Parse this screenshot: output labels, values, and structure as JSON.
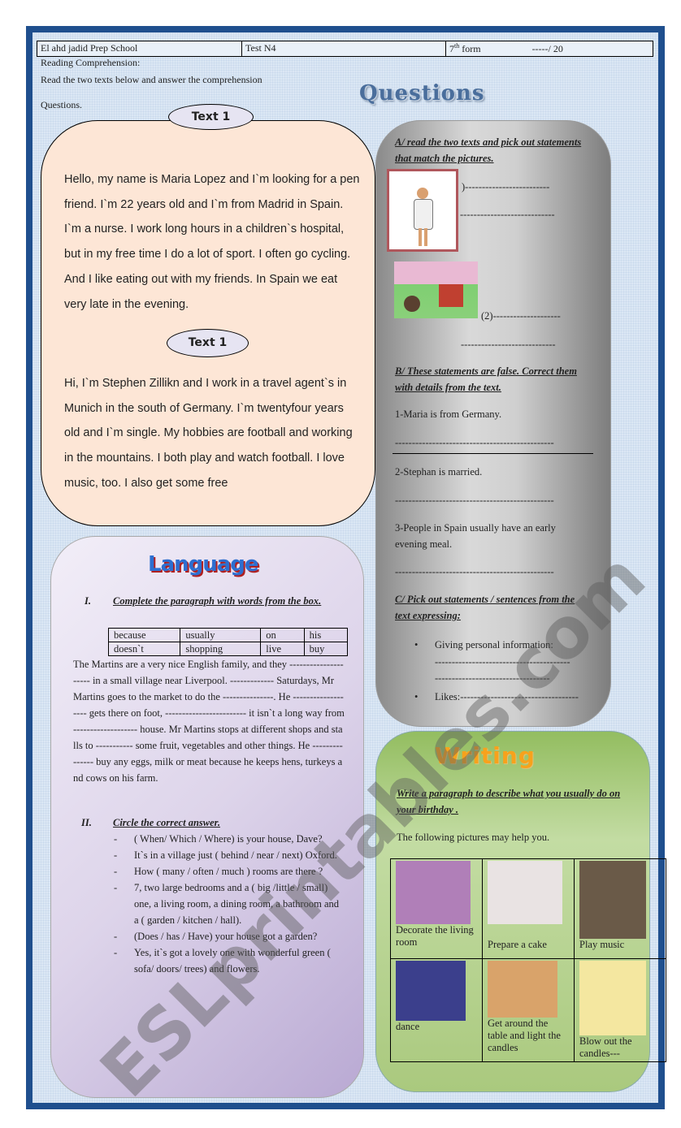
{
  "header": {
    "school": "El ahd jadid Prep School",
    "test": "Test N4",
    "form_num": "7",
    "form_sup": "th",
    "form_label": "form",
    "score": "-----/ 20"
  },
  "intro": {
    "section": "Reading Comprehension:",
    "instruction_1": "Read the two texts below and answer the comprehension",
    "instruction_2": "Questions."
  },
  "questions_title": "Questions",
  "text1": {
    "label": "Text 1",
    "paragraph": "Hello, my name is Maria Lopez and I`m looking for a pen friend. I`m 22 years old and I`m from Madrid in Spain. I`m a nurse. I work long hours in a children`s hospital, but in my free time I do a lot of sport. I often go cycling. And I like eating out with my friends. In Spain we eat very late in the evening."
  },
  "text2": {
    "label": "Text 1",
    "paragraph": "Hi, I`m Stephen Zillikn and I work in a travel agent`s in Munich in the south of Germany. I`m twentyfour years old and I`m single. My hobbies are football and working in the mountains. I both play and watch football. I love music, too. I also get some free"
  },
  "questions": {
    "a_title": "A/ read the two texts and pick out statements that match the pictures.",
    "a_line1": ")-------------------------",
    "a_line2": "----------------------------",
    "a_line3": "(2)--------------------",
    "a_line4": "----------------------------",
    "b_title": "B/ These statements are false. Correct them with details from the text.",
    "b_items": [
      "1-Maria is from Germany.",
      "2-Stephan is married.",
      "3-People in Spain usually have an early evening meal."
    ],
    "b_blank": "-----------------------------------------------",
    "c_title": "C/ Pick out statements / sentences from the text expressing:",
    "c_items": [
      "Giving personal information:",
      "Likes:-----------------------------------"
    ],
    "c_blank1": "----------------------------------------",
    "c_blank2": "----------------------------------"
  },
  "language": {
    "title": "Language",
    "i_num": "I.",
    "i_title": "Complete the paragraph with words from the box.",
    "box": [
      [
        "because",
        "usually",
        "on",
        "his"
      ],
      [
        "doesn`t",
        "shopping",
        "live",
        "buy"
      ]
    ],
    "paragraph": "The Martins are a very nice English family, and they --------------------- in a small village near Liverpool. ------------- Saturdays, Mr Martins goes to the market to do the ---------------. He ------------------- gets there on foot, ------------------------ it isn`t a long way from ------------------- house. Mr Martins stops at different shops and stalls to ----------- some fruit, vegetables and other things. He --------------- buy any eggs, milk or meat because he keeps hens, turkeys and cows on his farm.",
    "ii_num": "II.",
    "ii_title": "Circle the correct answer.",
    "ii_items": [
      "( When/ Which / Where) is your house, Dave?",
      "It`s in a village just ( behind / near / next) Oxford.",
      "How ( many / often / much ) rooms are there ?",
      "7, two large bedrooms and a ( big /little / small) one, a living room, a dining room, a bathroom and a ( garden / kitchen / hall).",
      "(Does / has / Have) your house got a garden?",
      "Yes, it`s got a lovely one with wonderful green ( sofa/ doors/ trees) and flowers."
    ]
  },
  "writing": {
    "title": "Writing",
    "task": "Write a paragraph to describe what you usually do on your birthday .",
    "hint": "The following pictures may help you.",
    "pictures": [
      {
        "caption": "Decorate the living room",
        "color": "#b07fb8"
      },
      {
        "caption": "Prepare a cake",
        "color": "#e9e3e3"
      },
      {
        "caption": "Play music",
        "color": "#6a5a48"
      },
      {
        "caption": "dance",
        "color": "#3b3f8c"
      },
      {
        "caption": "Get around the table and light the candles",
        "color": "#d9a36a"
      },
      {
        "caption": "Blow out the candles---",
        "color": "#f4e7a0"
      }
    ]
  },
  "watermark": "ESLprintables.com"
}
